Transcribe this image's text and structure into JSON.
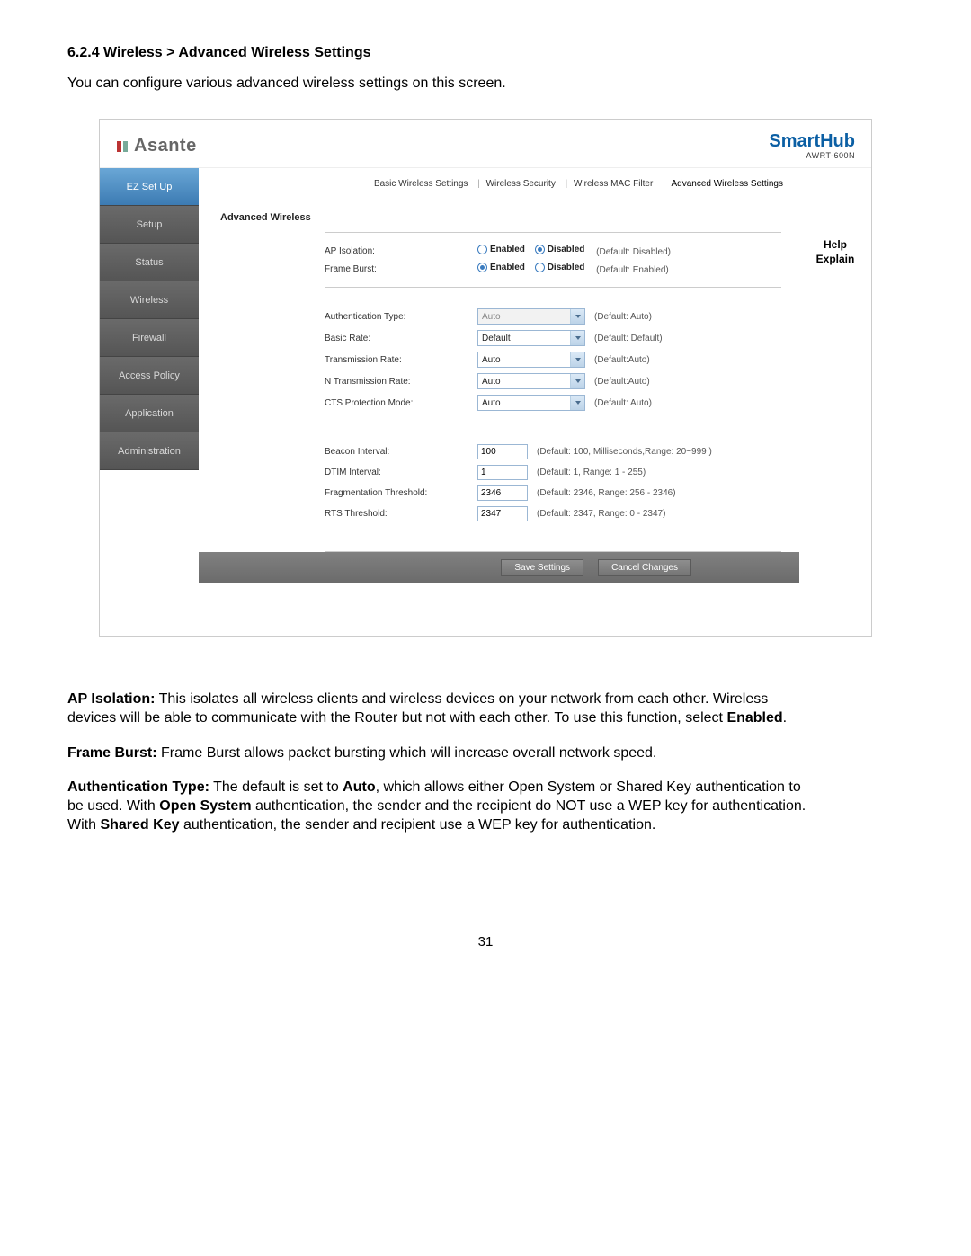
{
  "doc": {
    "heading": "6.2.4 Wireless > Advanced Wireless Settings",
    "intro": "You can configure various advanced wireless settings on this screen.",
    "page_number": "31",
    "para1_lead": "AP Isolation:",
    "para1_body_a": " This isolates all wireless clients and wireless devices on your network from each other. Wireless devices will be able to communicate with the Router but not with each other. To use this function, select ",
    "para1_bold": "Enabled",
    "para1_tail": ".",
    "para2_lead": "Frame Burst:",
    "para2_body": " Frame Burst allows packet bursting which will increase overall network speed.",
    "para3_lead": "Authentication Type:",
    "para3_a": " The default is set to ",
    "para3_b1": "Auto",
    "para3_b": ", which allows either Open System or Shared Key authentication to be used. With ",
    "para3_b2": "Open System",
    "para3_c": " authentication, the sender and the recipient do NOT use a WEP key for authentication. With ",
    "para3_b3": "Shared Key",
    "para3_d": " authentication, the sender and recipient use a WEP key for authentication."
  },
  "brand": {
    "left": "Asante",
    "right": "SmartHub",
    "model": "AWRT-600N"
  },
  "nav": {
    "items": [
      "EZ Set Up",
      "Setup",
      "Status",
      "Wireless",
      "Firewall",
      "Access Policy",
      "Application",
      "Administration"
    ]
  },
  "tabs": {
    "t1": "Basic Wireless Settings",
    "t2": "Wireless Security",
    "t3": "Wireless MAC Filter",
    "t4": "Advanced Wireless Settings"
  },
  "panel": {
    "title": "Advanced Wireless"
  },
  "help": {
    "line1": "Help",
    "line2": "Explain"
  },
  "options": {
    "enabled": "Enabled",
    "disabled": "Disabled"
  },
  "rows": {
    "ap_isolation": {
      "label": "AP Isolation:",
      "hint": "(Default: Disabled)"
    },
    "frame_burst": {
      "label": "Frame Burst:",
      "hint": "(Default: Enabled)"
    },
    "auth_type": {
      "label": "Authentication Type:",
      "value": "Auto",
      "hint": "(Default: Auto)"
    },
    "basic_rate": {
      "label": "Basic Rate:",
      "value": "Default",
      "hint": "(Default: Default)"
    },
    "tx_rate": {
      "label": "Transmission Rate:",
      "value": "Auto",
      "hint": "(Default:Auto)"
    },
    "n_tx_rate": {
      "label": "N Transmission Rate:",
      "value": "Auto",
      "hint": "(Default:Auto)"
    },
    "cts_mode": {
      "label": "CTS Protection Mode:",
      "value": "Auto",
      "hint": "(Default: Auto)"
    },
    "beacon": {
      "label": "Beacon Interval:",
      "value": "100",
      "hint": "(Default: 100, Milliseconds,Range: 20~999 )"
    },
    "dtim": {
      "label": "DTIM Interval:",
      "value": "1",
      "hint": "(Default: 1, Range: 1 - 255)"
    },
    "frag": {
      "label": "Fragmentation Threshold:",
      "value": "2346",
      "hint": "(Default: 2346, Range: 256 - 2346)"
    },
    "rts": {
      "label": "RTS Threshold:",
      "value": "2347",
      "hint": "(Default: 2347, Range: 0 - 2347)"
    }
  },
  "buttons": {
    "save": "Save Settings",
    "cancel": "Cancel Changes"
  }
}
